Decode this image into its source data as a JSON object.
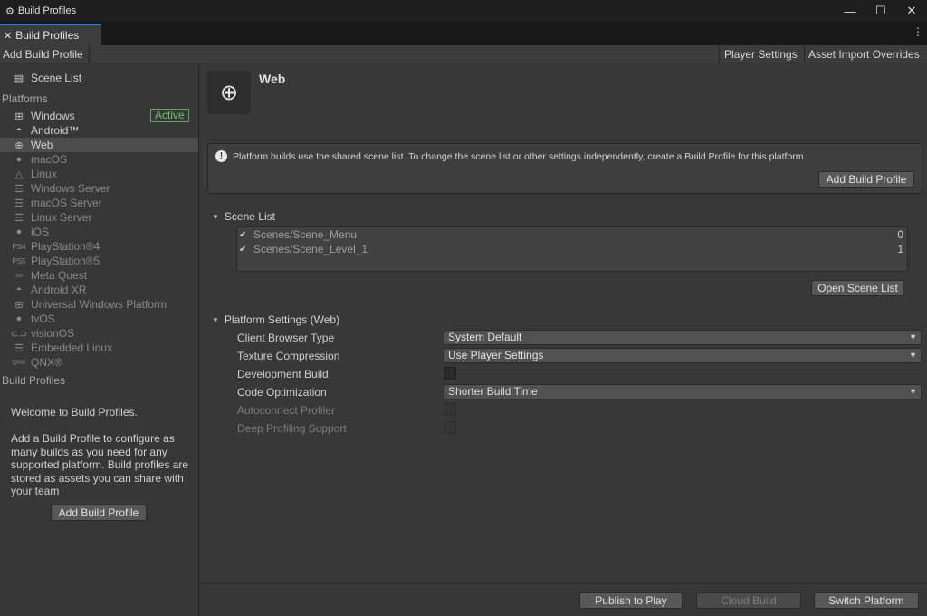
{
  "window": {
    "title": "Build Profiles"
  },
  "tab": {
    "label": "Build Profiles"
  },
  "toolbar": {
    "add_build_profile": "Add Build Profile",
    "player_settings": "Player Settings",
    "asset_import_overrides": "Asset Import Overrides"
  },
  "sidebar": {
    "scene_list_label": "Scene List",
    "platforms_header": "Platforms",
    "platforms": [
      {
        "label": "Windows",
        "icon": "windows-icon",
        "badge": "Active"
      },
      {
        "label": "Android™",
        "icon": "android-icon"
      },
      {
        "label": "Web",
        "icon": "globe-icon",
        "selected": true
      },
      {
        "label": "macOS",
        "icon": "apple-icon"
      },
      {
        "label": "Linux",
        "icon": "linux-icon"
      },
      {
        "label": "Windows Server",
        "icon": "server-icon"
      },
      {
        "label": "macOS Server",
        "icon": "server-icon"
      },
      {
        "label": "Linux Server",
        "icon": "server-icon"
      },
      {
        "label": "iOS",
        "icon": "apple-icon"
      },
      {
        "label": "PlayStation®4",
        "icon": "ps4-icon"
      },
      {
        "label": "PlayStation®5",
        "icon": "ps5-icon"
      },
      {
        "label": "Meta Quest",
        "icon": "meta-icon"
      },
      {
        "label": "Android XR",
        "icon": "android-icon"
      },
      {
        "label": "Universal Windows Platform",
        "icon": "windows-icon"
      },
      {
        "label": "tvOS",
        "icon": "apple-icon"
      },
      {
        "label": "visionOS",
        "icon": "visionos-icon"
      },
      {
        "label": "Embedded Linux",
        "icon": "server-icon"
      },
      {
        "label": "QNX®",
        "icon": "qnx-icon"
      }
    ],
    "build_profiles_header": "Build Profiles",
    "welcome_title": "Welcome to Build Profiles.",
    "welcome_body": "Add a Build Profile to configure as many builds as you need for any supported platform. Build profiles are stored as assets you can share with your team",
    "add_build_profile_button": "Add Build Profile"
  },
  "main": {
    "platform_title": "Web",
    "info_message": "Platform builds use the shared scene list. To change the scene list or other settings independently, create a Build Profile for this platform.",
    "info_add_button": "Add Build Profile",
    "scene_list_title": "Scene List",
    "scenes": [
      {
        "path": "Scenes/Scene_Menu",
        "index": "0",
        "checked": true
      },
      {
        "path": "Scenes/Scene_Level_1",
        "index": "1",
        "checked": true
      }
    ],
    "open_scene_list_button": "Open Scene List",
    "platform_settings_title": "Platform Settings (Web)",
    "settings": {
      "client_browser_type_label": "Client Browser Type",
      "client_browser_type_value": "System Default",
      "texture_compression_label": "Texture Compression",
      "texture_compression_value": "Use Player Settings",
      "development_build_label": "Development Build",
      "code_optimization_label": "Code Optimization",
      "code_optimization_value": "Shorter Build Time",
      "autoconnect_profiler_label": "Autoconnect Profiler",
      "deep_profiling_label": "Deep Profiling Support"
    }
  },
  "footer": {
    "publish_button": "Publish to Play",
    "cloud_build_button": "Cloud Build",
    "switch_platform_button": "Switch Platform"
  }
}
